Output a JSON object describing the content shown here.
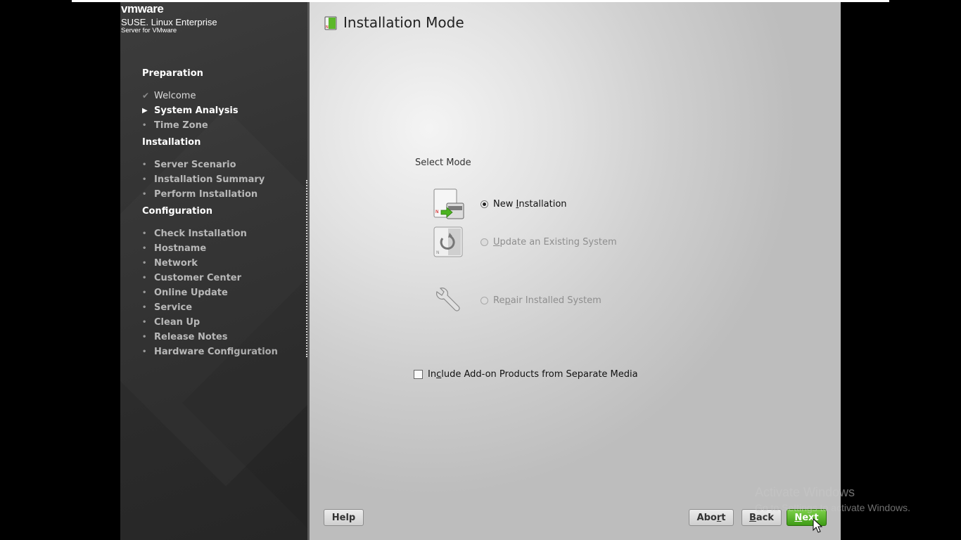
{
  "brand": {
    "vendor": "vmware",
    "product": "SUSE. Linux Enterprise",
    "edition": "Server for VMware"
  },
  "sidebar": {
    "sections": [
      {
        "title": "Preparation"
      },
      {
        "title": "Installation"
      },
      {
        "title": "Configuration"
      }
    ],
    "steps": {
      "welcome": "Welcome",
      "system_analysis": "System Analysis",
      "time_zone": "Time Zone",
      "server_scenario": "Server Scenario",
      "installation_summary": "Installation Summary",
      "perform_installation": "Perform Installation",
      "check_installation": "Check Installation",
      "hostname": "Hostname",
      "network": "Network",
      "customer_center": "Customer Center",
      "online_update": "Online Update",
      "service": "Service",
      "clean_up": "Clean Up",
      "release_notes": "Release Notes",
      "hardware_configuration": "Hardware Configuration"
    },
    "status_markers": {
      "done": "✔",
      "current": "▶",
      "pending": "•"
    }
  },
  "main": {
    "title": "Installation Mode",
    "select_mode_label": "Select Mode",
    "options": [
      {
        "label_pre": "New ",
        "label_u": "I",
        "label_post": "nstallation",
        "selected": true,
        "enabled": true,
        "icon": "new-installation-icon"
      },
      {
        "label_pre": "",
        "label_u": "U",
        "label_post": "pdate an Existing System",
        "selected": false,
        "enabled": false,
        "icon": "update-system-icon"
      },
      {
        "label_pre": "Re",
        "label_u": "p",
        "label_post": "air Installed System",
        "selected": false,
        "enabled": false,
        "icon": "repair-wrench-icon"
      }
    ],
    "addon_checkbox": {
      "label_pre": "In",
      "label_u": "c",
      "label_post": "lude Add-on Products from Separate Media",
      "checked": false
    }
  },
  "buttons": {
    "help": "Help",
    "abort_pre": "Abo",
    "abort_u": "r",
    "abort_post": "t",
    "back_u": "B",
    "back_post": "ack",
    "next_u": "N",
    "next_post": "ext"
  },
  "watermark": {
    "title": "Activate Windows",
    "subtitle": "Go to Settings to activate Windows."
  },
  "colors": {
    "accent_green": "#4caf1f",
    "sidebar_bg": "#333333",
    "panel_bg": "#d8d8d8"
  }
}
